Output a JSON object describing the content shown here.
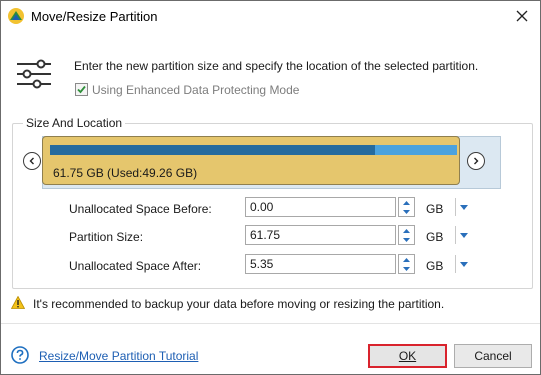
{
  "window": {
    "title": "Move/Resize Partition"
  },
  "intro": {
    "description": "Enter the new partition size and specify the location of the selected partition.",
    "checkbox_label": "Using Enhanced Data Protecting Mode",
    "checkbox_checked": true
  },
  "size_location": {
    "group_title": "Size And Location",
    "partition_label": "61.75 GB (Used:49.26 GB)",
    "used_fraction": 0.798,
    "colors": {
      "partition_fill": "#e5c66d",
      "used_bar": "#256b9e",
      "free_bar": "#4aa2dd",
      "unallocated_track": "#dce8f2"
    }
  },
  "fields": [
    {
      "label": "Unallocated Space Before:",
      "value": "0.00",
      "unit": "GB"
    },
    {
      "label": "Partition Size:",
      "value": "61.75",
      "unit": "GB"
    },
    {
      "label": "Unallocated Space After:",
      "value": "5.35",
      "unit": "GB"
    }
  ],
  "warning": {
    "text": "It's recommended to backup your data before moving or resizing the partition."
  },
  "footer": {
    "help_link": "Resize/Move Partition Tutorial",
    "ok_label": "OK",
    "cancel_label": "Cancel",
    "ok_highlight_color": "#d9232d"
  }
}
